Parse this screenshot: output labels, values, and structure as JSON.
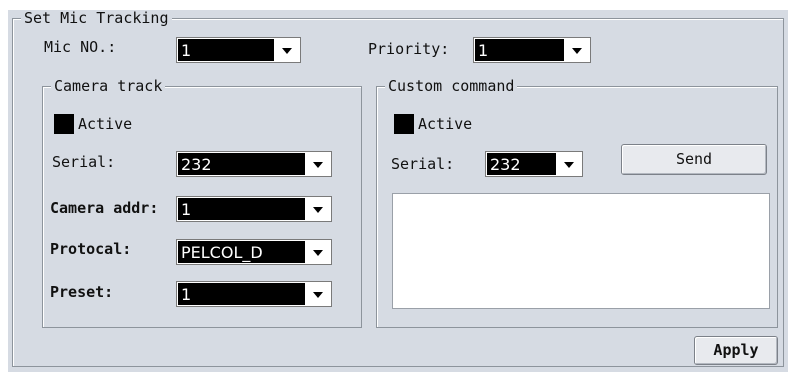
{
  "title": "Set Mic Tracking",
  "mic_no": {
    "label": "Mic NO.:",
    "value": "1"
  },
  "priority": {
    "label": "Priority:",
    "value": "1"
  },
  "camera_track": {
    "legend": "Camera track",
    "active_label": "Active",
    "serial": {
      "label": "Serial:",
      "value": "232"
    },
    "camera_addr": {
      "label": "Camera addr:",
      "value": "1"
    },
    "protocol": {
      "label": "Protocal:",
      "value": "PELCOL_D"
    },
    "preset": {
      "label": "Preset:",
      "value": "1"
    }
  },
  "custom_command": {
    "legend": "Custom command",
    "active_label": "Active",
    "serial": {
      "label": "Serial:",
      "value": "232"
    },
    "send_label": "Send",
    "command_text": ""
  },
  "apply_label": "Apply",
  "colors": {
    "panel_bg": "#d6dbe3",
    "selected_bg": "#000000"
  },
  "icons": {
    "dropdown": "chevron-down-icon"
  }
}
